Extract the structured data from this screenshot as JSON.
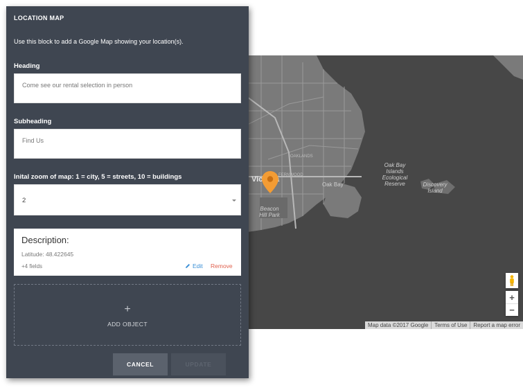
{
  "panel": {
    "title": "LOCATION MAP",
    "description": "Use this block to add a Google Map showing your location(s).",
    "heading_label": "Heading",
    "heading_value": "Come see our rental selection in person",
    "subheading_label": "Subheading",
    "subheading_value": "Find Us",
    "zoom_label": "Inital zoom of map: 1 = city, 5 = streets, 10 = buildings",
    "zoom_value": "2"
  },
  "object_card": {
    "title": "Description:",
    "latitude": "Latitude: 48.422645",
    "more_fields": "+4 fields",
    "edit_label": "Edit",
    "remove_label": "Remove"
  },
  "add_object": {
    "plus": "+",
    "label": "ADD OBJECT"
  },
  "actions": {
    "cancel": "CANCEL",
    "update": "UPDATE"
  },
  "map": {
    "labels": {
      "oak_bay_islands": "Oak Bay Islands Ecological Reserve",
      "discovery_island": "Discovery Island",
      "beacon_hill": "Beacon Hill Park",
      "oak_bay": "Oak Bay",
      "victoria": "Victoria",
      "oaklands": "OAKLANDS",
      "fernwood": "FERNWOOD"
    },
    "zoom_in": "+",
    "zoom_out": "−",
    "attribution": {
      "map_data": "Map data ©2017 Google",
      "terms": "Terms of Use",
      "report": "Report a map error"
    },
    "colors": {
      "water": "#474747",
      "land": "#7a7a7a",
      "pin": "#f39c34"
    }
  }
}
